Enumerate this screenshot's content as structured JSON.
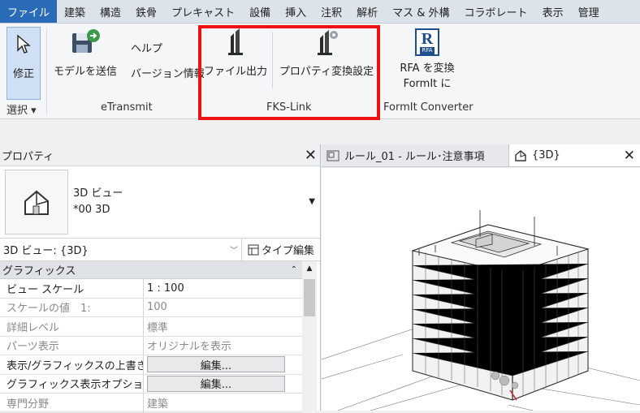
{
  "menu": {
    "tabs": [
      "ファイル",
      "建築",
      "構造",
      "鉄骨",
      "プレキャスト",
      "設備",
      "挿入",
      "注釈",
      "解析",
      "マス & 外構",
      "コラボレート",
      "表示",
      "管理"
    ]
  },
  "ribbon": {
    "modify_label": "修正",
    "select_label": "選択 ▾",
    "send_model_label": "モデルを送信",
    "help_label": "ヘルプ",
    "version_label": "バージョン情報",
    "etransmit_panel": "eTransmit",
    "file_output_label": "ファイル出力",
    "property_convert_label": "プロパティ変換設定",
    "fks_panel": "FKS-Link",
    "rfa_convert_line1": "RFA を変換",
    "rfa_convert_line2": "FormIt に",
    "rfa_icon_text": "R",
    "rfa_icon_sub": "RFA",
    "formit_panel": "FormIt Converter"
  },
  "properties": {
    "title": "プロパティ",
    "close": "✕",
    "type_line1": "3D ビュー",
    "type_line2": "*00 3D",
    "instance_selector": "3D ビュー: {3D}",
    "edit_type": "タイプ編集",
    "group": "グラフィックス",
    "rows": [
      {
        "name": "ビュー スケール",
        "value": "1 : 100"
      },
      {
        "name": "スケールの値　1:",
        "value": "100"
      },
      {
        "name": "詳細レベル",
        "value": "標準"
      },
      {
        "name": "パーツ表示",
        "value": "オリジナルを表示"
      },
      {
        "name": "表示/グラフィックスの上書き",
        "value": "編集..."
      },
      {
        "name": "グラフィックス表示オプション",
        "value": "編集..."
      },
      {
        "name": "専門分野",
        "value": "建築"
      }
    ]
  },
  "view_tabs": {
    "tab1": "ルール_01 - ルール･注意事項",
    "tab2": "{3D}",
    "close": "✕"
  },
  "colors": {
    "highlight_box": "#ee1111",
    "active_menu": "#2a6bb8"
  }
}
